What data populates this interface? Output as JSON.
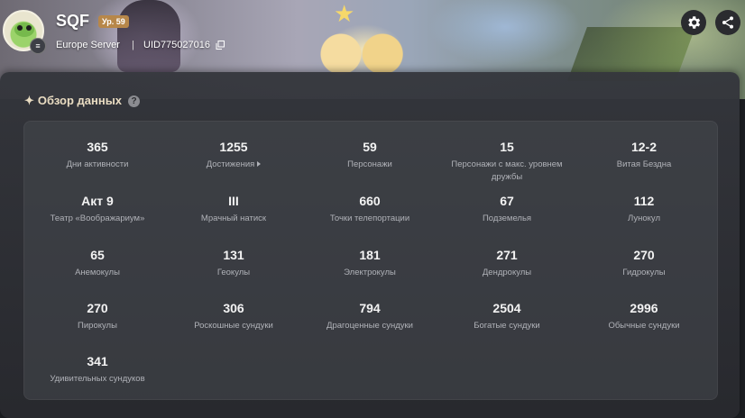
{
  "profile": {
    "name": "SQF",
    "level": "Ур. 59",
    "server": "Europe Server",
    "separator": "|",
    "uid": "UID775027016"
  },
  "section": {
    "title": "Обзор данных",
    "help": "?"
  },
  "stats": [
    {
      "value": "365",
      "label": "Дни активности"
    },
    {
      "value": "1255",
      "label": "Достижения"
    },
    {
      "value": "59",
      "label": "Персонажи"
    },
    {
      "value": "15",
      "label": "Персонажи с макс. уровнем дружбы"
    },
    {
      "value": "12-2",
      "label": "Витая Бездна"
    },
    {
      "value": "Акт 9",
      "label": "Театр «Воображариум»"
    },
    {
      "value": "III",
      "label": "Мрачный натиск"
    },
    {
      "value": "660",
      "label": "Точки телепортации"
    },
    {
      "value": "67",
      "label": "Подземелья"
    },
    {
      "value": "112",
      "label": "Лунокул"
    },
    {
      "value": "65",
      "label": "Анемокулы"
    },
    {
      "value": "131",
      "label": "Геокулы"
    },
    {
      "value": "181",
      "label": "Электрокулы"
    },
    {
      "value": "271",
      "label": "Дендрокулы"
    },
    {
      "value": "270",
      "label": "Гидрокулы"
    },
    {
      "value": "270",
      "label": "Пирокулы"
    },
    {
      "value": "306",
      "label": "Роскошные сундуки"
    },
    {
      "value": "794",
      "label": "Драгоценные сундуки"
    },
    {
      "value": "2504",
      "label": "Богатые сундуки"
    },
    {
      "value": "2996",
      "label": "Обычные сундуки"
    },
    {
      "value": "341",
      "label": "Удивительных сундуков"
    }
  ],
  "icons": {
    "settings": "gear-icon",
    "share": "share-icon",
    "copy": "copy-icon",
    "avatar_badge": "menu-icon"
  },
  "colors": {
    "level_badge": "#b7874a",
    "title": "#e9dcc2",
    "panel": "#2c2d31"
  }
}
